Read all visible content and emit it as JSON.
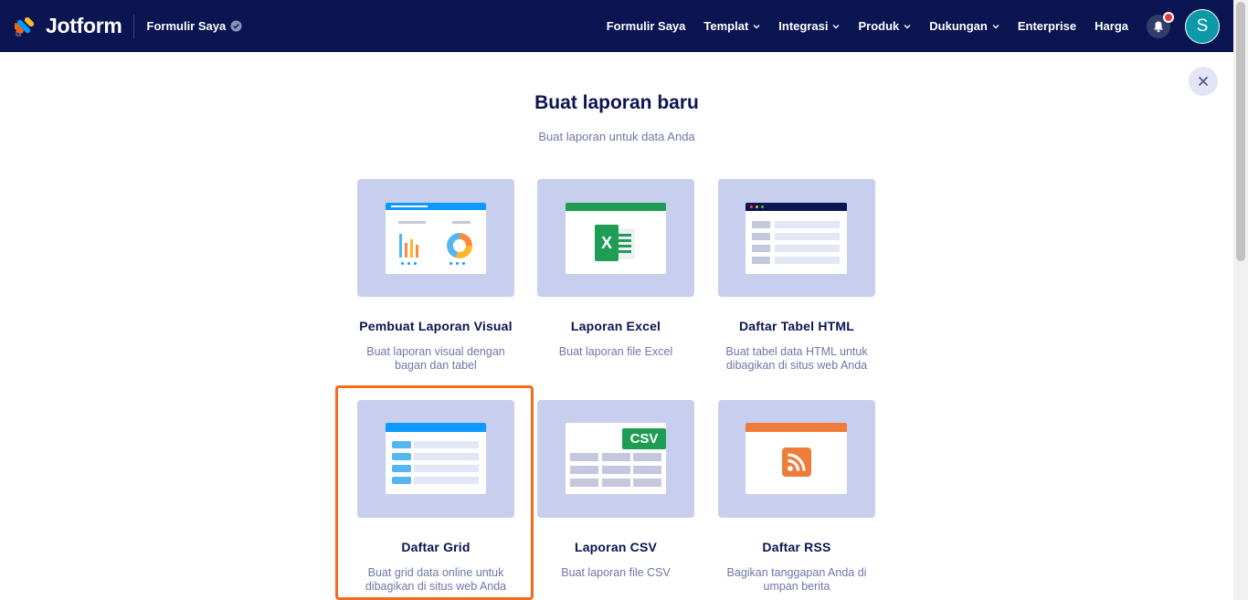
{
  "header": {
    "brand": "Jotform",
    "my_forms": "Formulir Saya",
    "nav": [
      {
        "label": "Formulir Saya",
        "dropdown": false
      },
      {
        "label": "Templat",
        "dropdown": true
      },
      {
        "label": "Integrasi",
        "dropdown": true
      },
      {
        "label": "Produk",
        "dropdown": true
      },
      {
        "label": "Dukungan",
        "dropdown": true
      },
      {
        "label": "Enterprise",
        "dropdown": false
      },
      {
        "label": "Harga",
        "dropdown": false
      }
    ],
    "avatar_initial": "S"
  },
  "page": {
    "title": "Buat laporan baru",
    "subtitle": "Buat laporan untuk data Anda",
    "close_icon": "close-icon"
  },
  "cards": [
    {
      "name": "Pembuat Laporan Visual",
      "desc": "Buat laporan visual dengan bagan dan tabel"
    },
    {
      "name": "Laporan Excel",
      "desc": "Buat laporan file Excel"
    },
    {
      "name": "Daftar Tabel HTML",
      "desc": "Buat tabel data HTML untuk dibagikan di situs web Anda"
    },
    {
      "name": "Daftar Grid",
      "desc": "Buat grid data online untuk dibagikan di situs web Anda"
    },
    {
      "name": "Laporan CSV",
      "desc": "Buat laporan file CSV",
      "badge": "CSV"
    },
    {
      "name": "Daftar RSS",
      "desc": "Bagikan tanggapan Anda di umpan berita"
    }
  ],
  "colors": {
    "header_bg": "#0a1551",
    "thumb_bg": "#c8ceed",
    "highlight": "#f36b1c",
    "excel_green": "#1f9d55",
    "rss_orange": "#ee7d3b",
    "blue": "#0d99ff"
  }
}
